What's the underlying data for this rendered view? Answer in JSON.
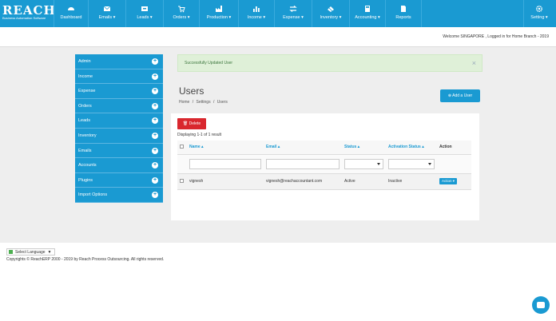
{
  "app": {
    "logo_text": "REACH",
    "logo_tagline": "Business Automation Software"
  },
  "nav": {
    "items": [
      {
        "label": "Dashboard",
        "icon": "dashboard-icon"
      },
      {
        "label": "Emails ▾",
        "icon": "envelope-icon"
      },
      {
        "label": "Leads ▾",
        "icon": "inbox-icon"
      },
      {
        "label": "Orders ▾",
        "icon": "cart-icon"
      },
      {
        "label": "Production ▾",
        "icon": "factory-icon"
      },
      {
        "label": "Income ▾",
        "icon": "bar-chart-icon"
      },
      {
        "label": "Expense ▾",
        "icon": "arrows-icon"
      },
      {
        "label": "Inventory ▾",
        "icon": "cubes-icon"
      },
      {
        "label": "Accounting ▾",
        "icon": "calculator-icon"
      },
      {
        "label": "Reports",
        "icon": "document-icon"
      },
      {
        "label": "Setting ▾",
        "icon": "gear-icon"
      }
    ]
  },
  "welcome_text": "Welcome SINGAPORE , Logged in for Home Branch - 2019",
  "sidebar": {
    "items": [
      {
        "label": "Admin"
      },
      {
        "label": "Income"
      },
      {
        "label": "Expense"
      },
      {
        "label": "Orders"
      },
      {
        "label": "Leads"
      },
      {
        "label": "Inventory"
      },
      {
        "label": "Emails"
      },
      {
        "label": "Accounts"
      },
      {
        "label": "Plugins"
      },
      {
        "label": "Import Options"
      }
    ]
  },
  "alert": {
    "message": "Successfully Updated User",
    "close": "×"
  },
  "page": {
    "title": "Users",
    "breadcrumb": [
      "Home",
      "/",
      "Settings",
      "/",
      "Users"
    ],
    "add_user_label": "Add a User"
  },
  "grid": {
    "delete_label": "Delete",
    "summary": "Displaying 1-1 of 1 result",
    "columns": [
      "Name ▴",
      "Email ▴",
      "Status ▴",
      "Activation Status ▴",
      "Action"
    ],
    "rows": [
      {
        "name": "vignesh",
        "email": "vignesh@reachaccountant.com",
        "status": "Active",
        "activation": "Inactive",
        "action": "Action ▾"
      }
    ]
  },
  "footer": {
    "language_label": "Select Language",
    "language_arrow": "▼",
    "copyright": "Copyrights © ReachERP 2000 - 2019 by Reach Process Outsourcing. All rights reserved."
  },
  "colors": {
    "brand": "#1a9ad2",
    "danger": "#d9272e",
    "success_bg": "#dff0d8"
  }
}
